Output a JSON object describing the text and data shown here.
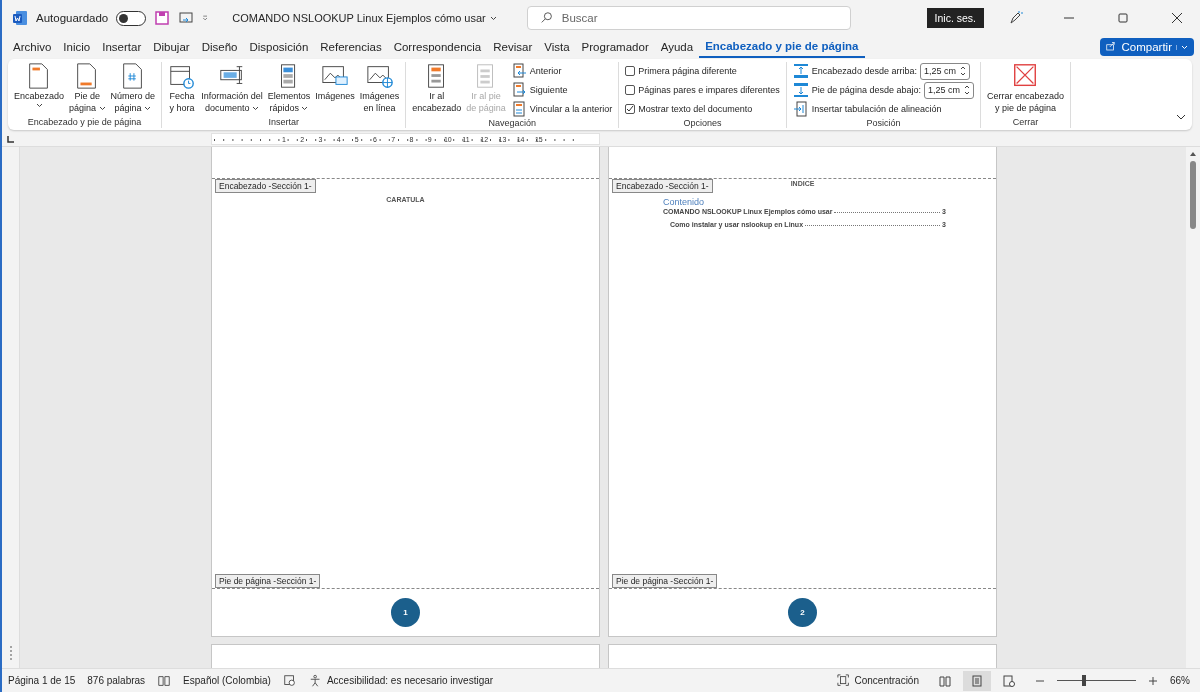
{
  "title_bar": {
    "autosave": {
      "label": "Autoguardado",
      "on": false
    },
    "document_title": "COMANDO NSLOOKUP Linux  Ejemplos cómo usar",
    "search": {
      "placeholder": "Buscar"
    },
    "sign_in": "Inic. ses."
  },
  "menu_tabs": [
    {
      "label": "Archivo",
      "selected": false
    },
    {
      "label": "Inicio",
      "selected": false
    },
    {
      "label": "Insertar",
      "selected": false
    },
    {
      "label": "Dibujar",
      "selected": false
    },
    {
      "label": "Diseño",
      "selected": false
    },
    {
      "label": "Disposición",
      "selected": false
    },
    {
      "label": "Referencias",
      "selected": false
    },
    {
      "label": "Correspondencia",
      "selected": false
    },
    {
      "label": "Revisar",
      "selected": false
    },
    {
      "label": "Vista",
      "selected": false
    },
    {
      "label": "Programador",
      "selected": false
    },
    {
      "label": "Ayuda",
      "selected": false
    },
    {
      "label": "Encabezado y pie de página",
      "selected": true
    }
  ],
  "share_button": "Compartir",
  "ribbon_groups": [
    {
      "label": "Encabezado y pie de página",
      "items": [
        {
          "kind": "large",
          "lines": [
            "Encabezado"
          ],
          "dropdown": true,
          "disabled": false
        },
        {
          "kind": "large",
          "lines": [
            "Pie de",
            "página"
          ],
          "dropdown": true,
          "disabled": false
        },
        {
          "kind": "large",
          "lines": [
            "Número de",
            "página"
          ],
          "dropdown": true,
          "disabled": false
        }
      ]
    },
    {
      "label": "Insertar",
      "items": [
        {
          "kind": "large",
          "lines": [
            "Fecha",
            "y hora"
          ],
          "dropdown": false,
          "disabled": false
        },
        {
          "kind": "large",
          "lines": [
            "Información del",
            "documento"
          ],
          "dropdown": true,
          "disabled": false
        },
        {
          "kind": "large",
          "lines": [
            "Elementos",
            "rápidos"
          ],
          "dropdown": true,
          "disabled": false
        },
        {
          "kind": "large",
          "lines": [
            "Imágenes"
          ],
          "dropdown": false,
          "disabled": false
        },
        {
          "kind": "large",
          "lines": [
            "Imágenes",
            "en línea"
          ],
          "dropdown": false,
          "disabled": false
        }
      ]
    },
    {
      "label": "Navegación",
      "items": [
        {
          "kind": "large",
          "lines": [
            "Ir al",
            "encabezado"
          ],
          "dropdown": false,
          "disabled": false
        },
        {
          "kind": "large",
          "lines": [
            "Ir al pie",
            "de página"
          ],
          "dropdown": false,
          "disabled": true
        },
        {
          "kind": "small",
          "label": "Anterior"
        },
        {
          "kind": "small",
          "label": "Siguiente"
        },
        {
          "kind": "small",
          "label": "Vincular a la anterior"
        }
      ]
    },
    {
      "label": "Opciones",
      "items": [
        {
          "kind": "checkbox",
          "label": "Primera página diferente",
          "checked": false
        },
        {
          "kind": "checkbox",
          "label": "Páginas pares e impares diferentes",
          "checked": false
        },
        {
          "kind": "checkbox",
          "label": "Mostrar texto del documento",
          "checked": true
        }
      ]
    },
    {
      "label": "Posición",
      "items": [
        {
          "kind": "spinner",
          "label": "Encabezado desde arriba:",
          "value": "1,25 cm"
        },
        {
          "kind": "spinner",
          "label": "Pie de página desde abajo:",
          "value": "1,25 cm"
        },
        {
          "kind": "small",
          "label": "Insertar tabulación de alineación"
        }
      ]
    },
    {
      "label": "Cerrar",
      "items": [
        {
          "kind": "large",
          "lines": [
            "Cerrar encabezado",
            "y pie de página"
          ],
          "dropdown": false,
          "disabled": false
        }
      ]
    }
  ],
  "ruler_numbers": [
    "1",
    "2",
    "3",
    "4",
    "5",
    "6",
    "7",
    "8",
    "9",
    "10",
    "11",
    "12",
    "13",
    "14",
    "15"
  ],
  "pages": [
    {
      "kind": "cover",
      "header_tag": "Encabezado -Sección 1-",
      "title": "CARATULA",
      "footer_tag": "Pie de página -Sección 1-",
      "page_number": "1"
    },
    {
      "kind": "index",
      "header_tag": "Encabezado -Sección 1-",
      "title": "INDICE",
      "toc_heading": "Contenido",
      "toc": [
        {
          "text": "COMANDO NSLOOKUP Linux  Ejemplos cómo usar",
          "page": "3",
          "children": [
            {
              "text": "Como instalar y usar nslookup en Linux",
              "page": "3"
            }
          ]
        }
      ],
      "footer_tag": "Pie de página -Sección 1-",
      "page_number": "2"
    }
  ],
  "status_bar": {
    "page": "Página 1 de 15",
    "words": "876 palabras",
    "language": "Español (Colombia)",
    "accessibility": "Accesibilidad: es necesario investigar",
    "focus": "Concentración",
    "views": [
      {
        "selected": false
      },
      {
        "selected": true
      },
      {
        "selected": false
      }
    ],
    "zoom": {
      "level": 0.33,
      "reading": "66%"
    }
  }
}
